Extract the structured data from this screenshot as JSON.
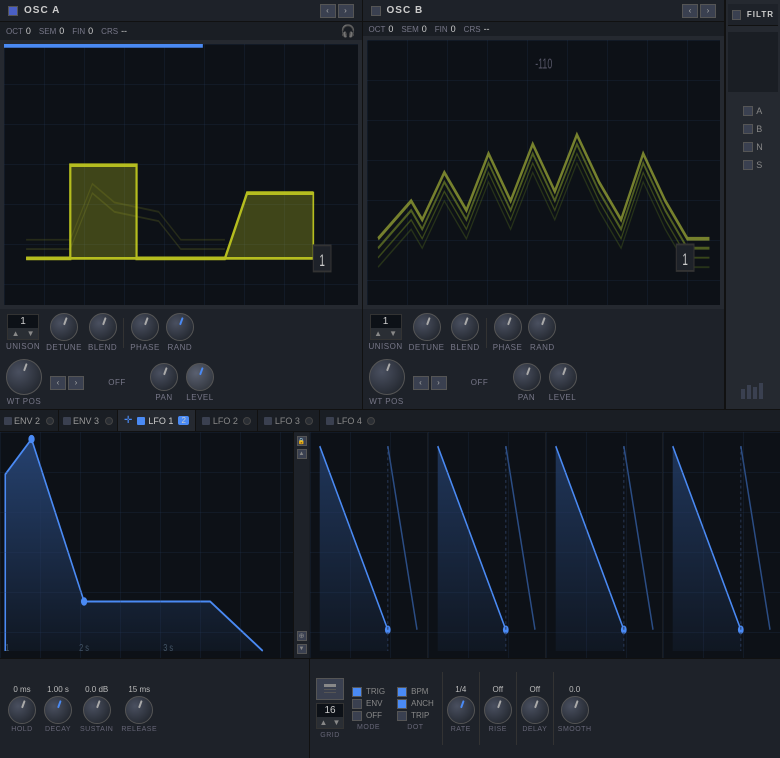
{
  "osc_a": {
    "title": "OSC A",
    "oct": "0",
    "sem": "0",
    "fin": "0",
    "crs": "--",
    "unison": "1",
    "detune_label": "DETUNE",
    "blend_label": "BLEND",
    "phase_label": "PHASE",
    "rand_label": "RAND",
    "wt_pos_label": "WT POS",
    "off_label": "OFF",
    "pan_label": "PAN",
    "level_label": "LEVEL",
    "wt_num": "1"
  },
  "osc_b": {
    "title": "OSC B",
    "oct": "0",
    "sem": "0",
    "fin": "0",
    "crs": "--",
    "unison": "1",
    "detune_label": "DETUNE",
    "blend_label": "BLEND",
    "phase_label": "PHASE",
    "rand_label": "RAND",
    "wt_pos_label": "WT POS",
    "off_label": "OFF",
    "pan_label": "PAN",
    "level_label": "LEVEL",
    "wt_num": "1"
  },
  "filter": {
    "title": "FILTR",
    "a_label": "A",
    "b_label": "B",
    "n_label": "N",
    "s_label": "S"
  },
  "env": {
    "env2_label": "ENV 2",
    "env3_label": "ENV 3",
    "hold_val": "0 ms",
    "hold_label": "HOLD",
    "decay_val": "1.00 s",
    "decay_label": "DECAY",
    "sustain_val": "0.0 dB",
    "sustain_label": "SUSTAIN",
    "release_val": "15 ms",
    "release_label": "RELEASE",
    "time_1": "1",
    "time_2": "2 s",
    "time_3": "3 s"
  },
  "lfo": {
    "lfo1_label": "LFO 1",
    "lfo2_label": "LFO 2",
    "lfo3_label": "LFO 3",
    "lfo4_label": "LFO 4",
    "lfo1_num": "2",
    "grid_val": "16",
    "trig_label": "TRIG",
    "bpm_label": "BPM",
    "env_label": "ENV",
    "anch_label": "ANCH",
    "off_label": "OFF",
    "trip_label": "TRIP",
    "mode_label": "MODE",
    "dot_label": "DOT",
    "rate_label": "RATE",
    "time_label": "1/4",
    "rise_label": "RISE",
    "rise_val": "Off",
    "delay_label": "DELAY",
    "delay_val": "Off",
    "smooth_label": "SMOOTH",
    "smooth_val": "0.0"
  },
  "colors": {
    "accent_blue": "#4a8af4",
    "accent_yellow": "#c8d020",
    "panel_bg": "#252930",
    "dark_bg": "#0d1117",
    "border": "#333"
  }
}
